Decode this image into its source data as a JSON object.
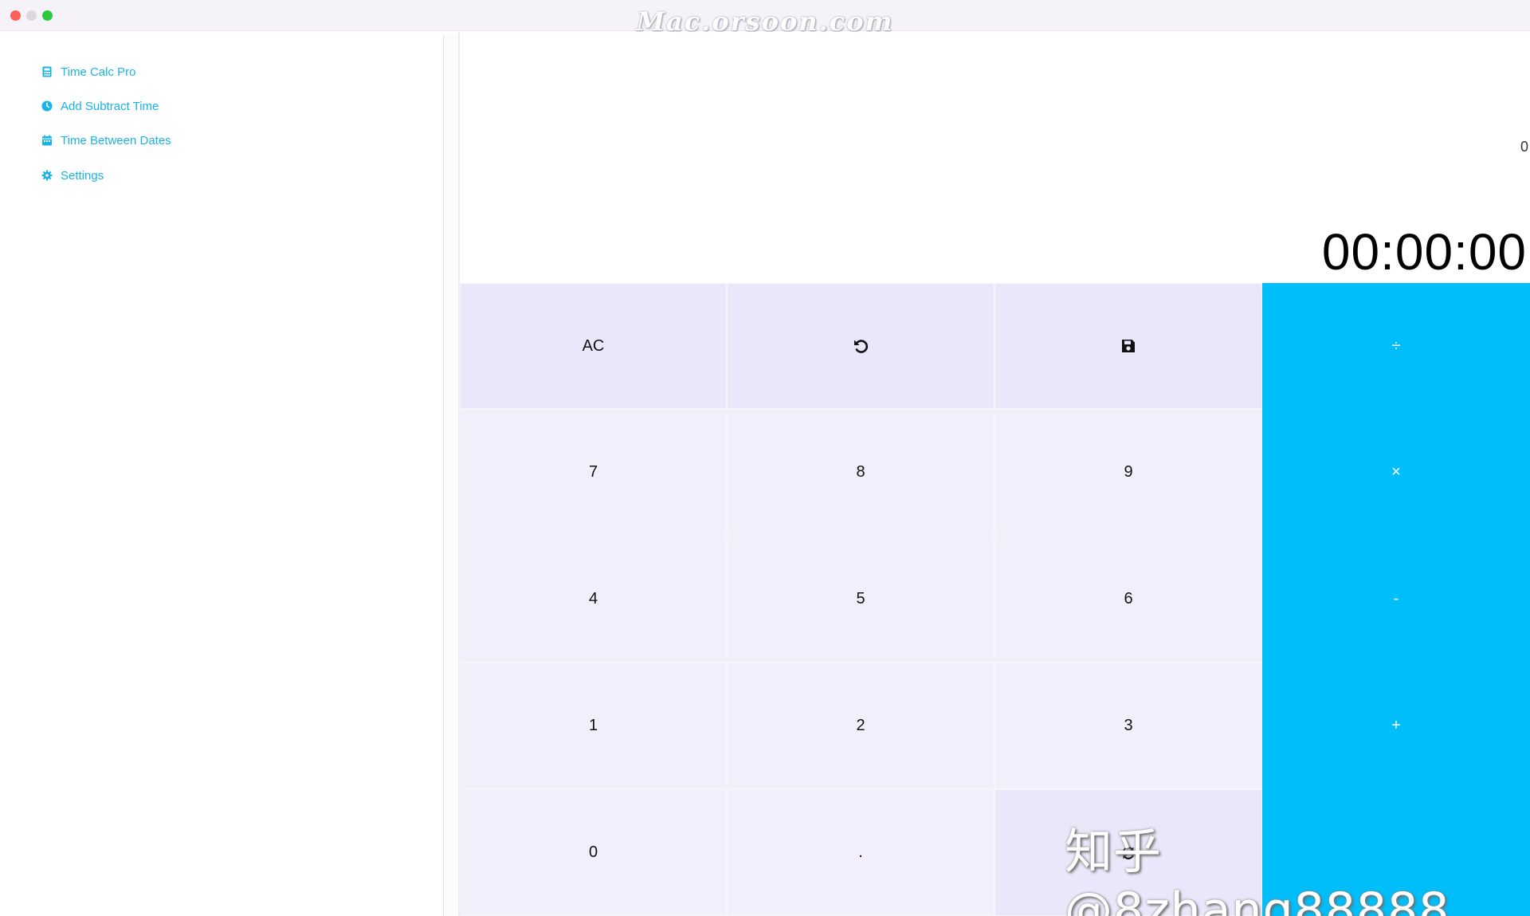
{
  "watermarks": {
    "top": "Mac.orsoon.com",
    "bottom": "知乎 @8zhang88888"
  },
  "sidebar": {
    "items": [
      {
        "label": "Time Calc Pro",
        "icon": "calculator-icon"
      },
      {
        "label": "Add Subtract Time",
        "icon": "clock-icon"
      },
      {
        "label": "Time Between Dates",
        "icon": "calendar-icon"
      },
      {
        "label": "Settings",
        "icon": "gear-icon"
      }
    ]
  },
  "display": {
    "secondary": "0",
    "primary": "00:00:00"
  },
  "keypad": {
    "ac": "AC",
    "undo_icon": "undo-icon",
    "save_icon": "save-icon",
    "divide": "÷",
    "k7": "7",
    "k8": "8",
    "k9": "9",
    "multiply": "×",
    "k4": "4",
    "k5": "5",
    "k6": "6",
    "subtract": "-",
    "k1": "1",
    "k2": "2",
    "k3": "3",
    "add": "+",
    "k0": "0",
    "dot": ".",
    "convert_icon": "convert-icon"
  },
  "colors": {
    "accent": "#00bef9",
    "link": "#19b3e6",
    "key_bg": "#f2eefb",
    "fn_key_bg": "#ebe6f9"
  }
}
